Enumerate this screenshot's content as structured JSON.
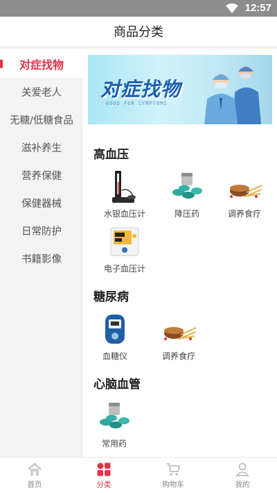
{
  "status_bar": {
    "time": "12:57"
  },
  "header": {
    "title": "商品分类"
  },
  "sidebar": {
    "items": [
      {
        "label": "对症找物",
        "active": true
      },
      {
        "label": "关爱老人"
      },
      {
        "label": "无糖/低糖食品"
      },
      {
        "label": "滋补养生"
      },
      {
        "label": "营养保健"
      },
      {
        "label": "保健器械"
      },
      {
        "label": "日常防护"
      },
      {
        "label": "书籍影像"
      }
    ]
  },
  "banner": {
    "title": "对症找物",
    "subtitle": "GOOD FOR SYMPTOMS"
  },
  "sections": [
    {
      "title": "高血压",
      "products": [
        {
          "label": "水银血压计",
          "icon": "mercury-sphygmomanometer-icon"
        },
        {
          "label": "降压药",
          "icon": "pills-icon"
        },
        {
          "label": "调养食疗",
          "icon": "herbal-food-icon"
        },
        {
          "label": "电子血压计",
          "icon": "electronic-bp-monitor-icon"
        }
      ]
    },
    {
      "title": "糖尿病",
      "products": [
        {
          "label": "血糖仪",
          "icon": "glucose-meter-icon"
        },
        {
          "label": "调养食疗",
          "icon": "herbal-food-icon"
        }
      ]
    },
    {
      "title": "心脑血管",
      "products": [
        {
          "label": "常用药",
          "icon": "pills-icon"
        }
      ]
    }
  ],
  "tabbar": {
    "items": [
      {
        "label": "首页",
        "icon": "home-icon"
      },
      {
        "label": "分类",
        "icon": "category-icon",
        "active": true
      },
      {
        "label": "购物车",
        "icon": "cart-icon"
      },
      {
        "label": "我的",
        "icon": "user-icon"
      }
    ]
  },
  "colors": {
    "accent": "#e4334a",
    "sidebar_bg": "#f3f3f3",
    "status_bar": "#8c8c8c"
  }
}
